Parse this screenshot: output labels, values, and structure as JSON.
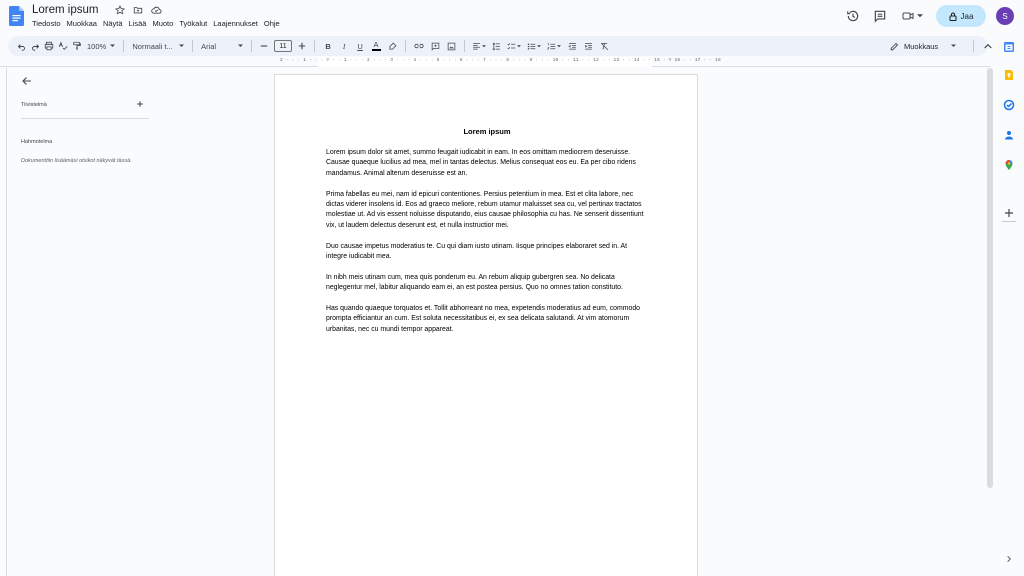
{
  "header": {
    "title": "Lorem ipsum",
    "menu": [
      "Tiedosto",
      "Muokkaa",
      "Näytä",
      "Lisää",
      "Muoto",
      "Työkalut",
      "Laajennukset",
      "Ohje"
    ],
    "share_label": "Jaa",
    "avatar_initial": "S"
  },
  "toolbar": {
    "zoom": "100%",
    "style": "Normaali t...",
    "font": "Arial",
    "font_size": "11",
    "bold": "B",
    "italic": "I",
    "underline": "U",
    "text_color": "A",
    "mode": "Muokkaus"
  },
  "ruler": {
    "numbers": "2 · · · 1 · · · ▽ · · 1 · · · 2 · · · 3 · · · 4 · · · 5 · · · 6 · · · 7 · · · 8 · · · 9 · · · 10 · · 11 · · 12 · · 13 · · 14 · · 15 · ▽ 16 · · 17 · · 18"
  },
  "outline": {
    "summary_label": "Tiivistelmä",
    "outline_label": "Hahmotelma",
    "hint": "Dokumenttiin lisäämäsi otsikot näkyvät tässä."
  },
  "document": {
    "heading": "Lorem ipsum",
    "paragraphs": [
      "Lorem ipsum dolor sit amet, summo feugait iudicabit in eam. In eos omittam mediocrem deseruisse. Causae quaeque lucilius ad mea, mel in tantas delectus. Melius consequat eos eu. Ea per cibo ridens mandamus. Animal alterum deseruisse est an.",
      "Prima fabellas eu mei, nam id epicuri contentiones. Persius petentium in mea. Est et clita labore, nec dictas viderer insolens id. Eos ad graeco meliore, rebum utamur maluisset sea cu, vel pertinax tractatos molestiae ut. Ad vis essent noluisse disputando, eius causae philosophia cu has. Ne senserit dissentiunt vix, ut laudem delectus deserunt est, et nulla instructior mei.",
      "Duo causae impetus moderatius te. Cu qui diam iusto utinam. Iisque principes elaboraret sed in. At integre iudicabit mea.",
      "In nibh meis utinam cum, mea quis ponderum eu. An rebum aliquip gubergren sea. No delicata neglegentur mel, labitur aliquando eam ei, an est postea persius. Quo no omnes tation constituto.",
      "Has quando quaeque torquatos et. Tollit abhorreant no mea, expetendis moderatius ad eum, commodo prompta efficiantur an cum. Est soluta necessitatibus ei, ex sea delicata salutandi. At vim atomorum urbanitas, nec cu mundi tempor appareat."
    ]
  },
  "colors": {
    "docs_blue": "#4285f4",
    "share_bg": "#c2e7ff",
    "avatar_bg": "#6a3fb5",
    "toolbar_bg": "#edf2fa"
  }
}
